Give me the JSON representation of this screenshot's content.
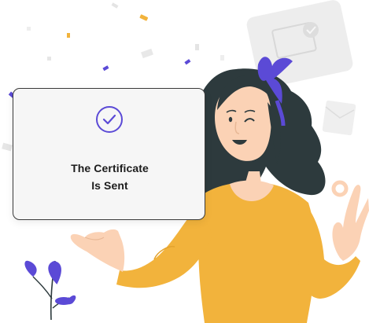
{
  "card": {
    "title_line1": "The Certificate",
    "title_line2": "Is Sent",
    "check_icon": "check-circle-icon"
  },
  "colors": {
    "accent": "#5b4ad6",
    "shirt": "#f2b33c",
    "hair": "#2d3a3d",
    "skin": "#fbd2b5",
    "card_background": "#f6f6f6"
  }
}
